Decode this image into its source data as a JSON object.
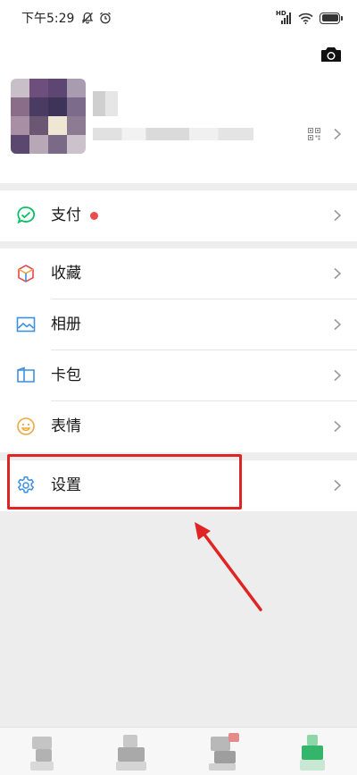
{
  "status_bar": {
    "time": "下午5:29",
    "network_label": "HD"
  },
  "profile": {
    "camera_icon": "camera-icon",
    "qr_icon": "qr-code-icon"
  },
  "menu": {
    "pay": {
      "label": "支付",
      "icon": "wechat-pay-icon",
      "has_red_dot": true
    },
    "favorites": {
      "label": "收藏",
      "icon": "favorites-cube-icon"
    },
    "album": {
      "label": "相册",
      "icon": "album-image-icon"
    },
    "cards": {
      "label": "卡包",
      "icon": "card-wallet-icon"
    },
    "stickers": {
      "label": "表情",
      "icon": "smiley-icon"
    },
    "settings": {
      "label": "设置",
      "icon": "gear-icon"
    }
  },
  "annotation": {
    "highlight_color": "#e02424",
    "target": "settings"
  },
  "colors": {
    "page_background": "#ededed",
    "row_background": "#ffffff",
    "pay_green": "#07c160",
    "red_dot": "#e94c4c"
  },
  "tab_bar": {
    "tabs": [
      "tab-1",
      "tab-2",
      "tab-3",
      "tab-4"
    ],
    "active_tab": "tab-4"
  }
}
